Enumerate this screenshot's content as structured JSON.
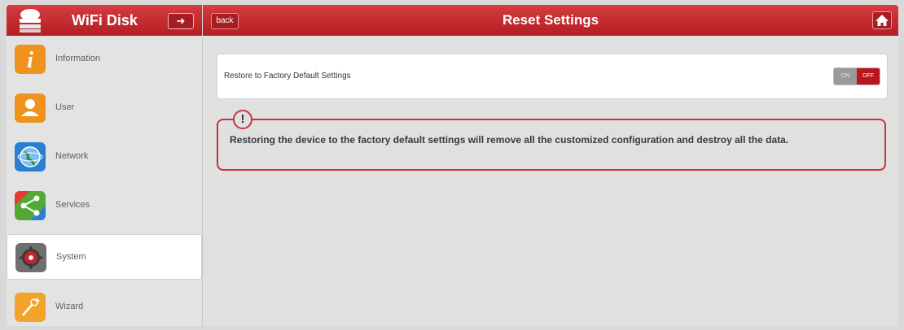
{
  "header": {
    "app_title": "WiFi Disk",
    "page_title": "Reset Settings",
    "back_label": "back",
    "logout_glyph": "➜"
  },
  "sidebar": {
    "items": [
      {
        "label": "Information",
        "icon": "info-icon",
        "color": "#f0931d"
      },
      {
        "label": "User",
        "icon": "user-icon",
        "color": "#f0931d"
      },
      {
        "label": "Network",
        "icon": "globe-icon",
        "color": "#2b7fd1"
      },
      {
        "label": "Services",
        "icon": "share-icon",
        "color": "#53a935"
      },
      {
        "label": "System",
        "icon": "gear-icon",
        "color": "#6f6f6f",
        "active": true
      },
      {
        "label": "Wizard",
        "icon": "wand-icon",
        "color": "#f2a42a"
      }
    ]
  },
  "main": {
    "setting_label": "Restore to Factory Default Settings",
    "toggle": {
      "on_label": "ON",
      "off_label": "OFF",
      "state": "off"
    },
    "warning_symbol": "!",
    "warning_text": "Restoring the device to the factory default settings will remove all the customized configuration and destroy all the data."
  },
  "colors": {
    "accent": "#c12328",
    "warning_border": "#c6343a"
  }
}
